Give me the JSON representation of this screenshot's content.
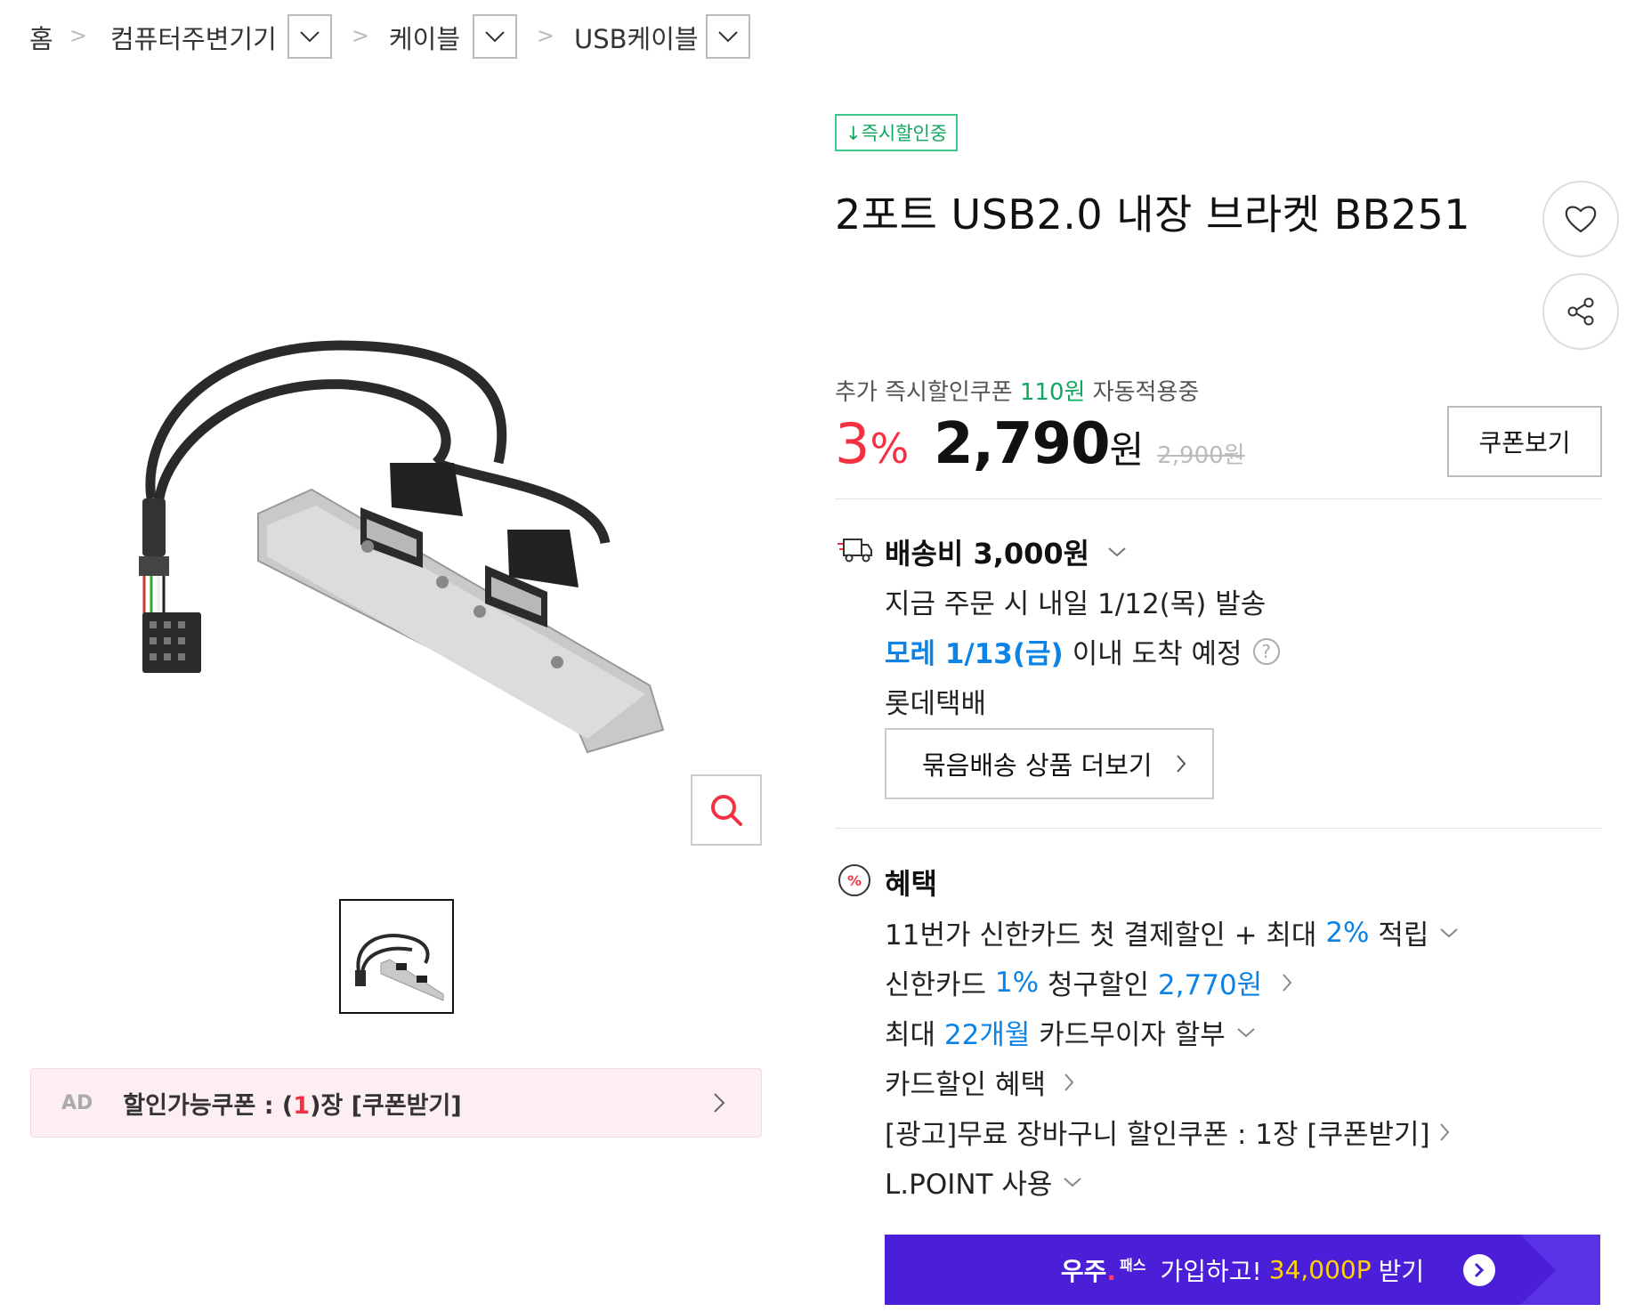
{
  "breadcrumb": {
    "home": "홈",
    "level1": "컴퓨터주변기기",
    "level2": "케이블",
    "level3": "USB케이블"
  },
  "ad": {
    "tag": "AD",
    "prefix": "할인가능쿠폰 : (",
    "count": "1",
    "suffix": ")장 [쿠폰받기]"
  },
  "product": {
    "badge": "↓즉시할인중",
    "title": "2포트 USB2.0 내장 브라켓 BB251"
  },
  "price": {
    "coupon_prefix": "추가 즉시할인쿠폰",
    "coupon_amount": "110원",
    "coupon_suffix": "자동적용중",
    "discount_num": "3",
    "discount_pct": "%",
    "sale_price": "2,790",
    "won": "원",
    "original_price": "2,900원",
    "coupon_button": "쿠폰보기"
  },
  "shipping": {
    "title": "배송비 3,000원",
    "dispatch": "지금 주문 시 내일 1/12(목) 발송",
    "arrival_highlight": "모레 1/13(금)",
    "arrival_rest": "이내 도착 예정",
    "help": "?",
    "courier": "롯데택배",
    "bundle_button": "묶음배송 상품 더보기"
  },
  "benefits": {
    "title": "혜택",
    "items": [
      {
        "pre": "11번가 신한카드 첫 결제할인 + 최대 ",
        "hl": "2%",
        "post": " 적립",
        "arrow": "chevron-down"
      },
      {
        "pre": "신한카드 ",
        "hl": "1%",
        "post": " 청구할인 ",
        "hl2": "2,770원",
        "arrow": "chevron-right"
      },
      {
        "pre": "최대 ",
        "hl": "22개월",
        "post": " 카드무이자 할부",
        "arrow": "chevron-down"
      },
      {
        "pre": "카드할인 혜택",
        "arrow": "chevron-right"
      },
      {
        "pre": "[광고]무료 장바구니 할인쿠폰 : 1장 [쿠폰받기]",
        "arrow": "chevron-right"
      },
      {
        "pre": "L.POINT 사용",
        "arrow": "chevron-down"
      }
    ]
  },
  "pass_banner": {
    "logo": "우주",
    "logo_small": "패스",
    "text_pre": "가입하고!",
    "points": "34,000P",
    "text_post": "받기"
  },
  "colors": {
    "accent_red": "#f43142",
    "green": "#10a860",
    "blue": "#0b83e6",
    "banner_purple": "#4b1fd8",
    "banner_yellow": "#ffd400"
  },
  "icons": [
    "chevron-right-icon",
    "chevron-down-icon",
    "search-icon",
    "heart-icon",
    "share-icon",
    "truck-icon",
    "percent-icon",
    "help-icon"
  ]
}
